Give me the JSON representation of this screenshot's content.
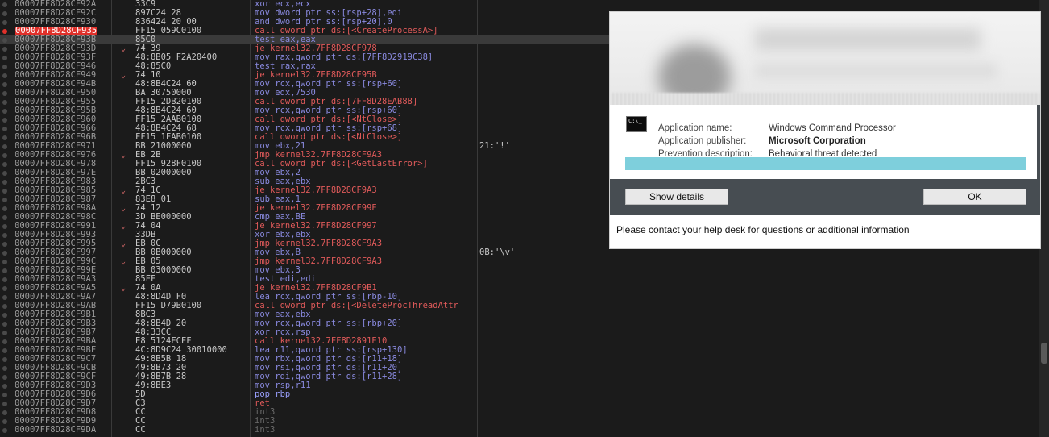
{
  "disasm": {
    "rows": [
      {
        "addr": "00007FF8D28CF92A",
        "jmp": "",
        "bytes": "33C9",
        "instr": "xor ecx,ecx",
        "kind": "",
        "cmt": ""
      },
      {
        "addr": "00007FF8D28CF92C",
        "jmp": "",
        "bytes": "897C24 28",
        "instr": "mov dword ptr ss:[rsp+28],edi",
        "kind": "",
        "cmt": ""
      },
      {
        "addr": "00007FF8D28CF930",
        "jmp": "",
        "bytes": "836424 20 00",
        "instr": "and dword ptr ss:[rsp+20],0",
        "kind": "",
        "cmt": ""
      },
      {
        "addr": "00007FF8D28CF935",
        "jmp": "",
        "bytes": "FF15 059C0100",
        "instr": "call qword ptr ds:[<CreateProcessA>]",
        "kind": "call",
        "cmt": "",
        "bp": true
      },
      {
        "addr": "00007FF8D28CF93B",
        "jmp": "",
        "bytes": "85C0",
        "instr": "test eax,eax",
        "kind": "",
        "cmt": "",
        "cur": true
      },
      {
        "addr": "00007FF8D28CF93D",
        "jmp": "⌄",
        "bytes": "74 39",
        "instr": "je kernel32.7FF8D28CF978",
        "kind": "jcc",
        "cmt": ""
      },
      {
        "addr": "00007FF8D28CF93F",
        "jmp": "",
        "bytes": "48:8B05 F2A20400",
        "instr": "mov rax,qword ptr ds:[7FF8D2919C38]",
        "kind": "",
        "cmt": ""
      },
      {
        "addr": "00007FF8D28CF946",
        "jmp": "",
        "bytes": "48:85C0",
        "instr": "test rax,rax",
        "kind": "",
        "cmt": ""
      },
      {
        "addr": "00007FF8D28CF949",
        "jmp": "⌄",
        "bytes": "74 10",
        "instr": "je kernel32.7FF8D28CF95B",
        "kind": "jcc",
        "cmt": ""
      },
      {
        "addr": "00007FF8D28CF94B",
        "jmp": "",
        "bytes": "48:8B4C24 60",
        "instr": "mov rcx,qword ptr ss:[rsp+60]",
        "kind": "",
        "cmt": ""
      },
      {
        "addr": "00007FF8D28CF950",
        "jmp": "",
        "bytes": "BA 30750000",
        "instr": "mov edx,7530",
        "kind": "",
        "cmt": ""
      },
      {
        "addr": "00007FF8D28CF955",
        "jmp": "",
        "bytes": "FF15 2DB20100",
        "instr": "call qword ptr ds:[7FF8D28EAB88]",
        "kind": "call",
        "cmt": ""
      },
      {
        "addr": "00007FF8D28CF95B",
        "jmp": "",
        "bytes": "48:8B4C24 60",
        "instr": "mov rcx,qword ptr ss:[rsp+60]",
        "kind": "",
        "cmt": ""
      },
      {
        "addr": "00007FF8D28CF960",
        "jmp": "",
        "bytes": "FF15 2AAB0100",
        "instr": "call qword ptr ds:[<NtClose>]",
        "kind": "call",
        "cmt": ""
      },
      {
        "addr": "00007FF8D28CF966",
        "jmp": "",
        "bytes": "48:8B4C24 68",
        "instr": "mov rcx,qword ptr ss:[rsp+68]",
        "kind": "",
        "cmt": ""
      },
      {
        "addr": "00007FF8D28CF96B",
        "jmp": "",
        "bytes": "FF15 1FAB0100",
        "instr": "call qword ptr ds:[<NtClose>]",
        "kind": "call",
        "cmt": ""
      },
      {
        "addr": "00007FF8D28CF971",
        "jmp": "",
        "bytes": "BB 21000000",
        "instr": "mov ebx,21",
        "kind": "",
        "cmt": "21:'!'"
      },
      {
        "addr": "00007FF8D28CF976",
        "jmp": "⌄",
        "bytes": "EB 2B",
        "instr": "jmp kernel32.7FF8D28CF9A3",
        "kind": "jcc",
        "cmt": ""
      },
      {
        "addr": "00007FF8D28CF978",
        "jmp": "",
        "bytes": "FF15 928F0100",
        "instr": "call qword ptr ds:[<GetLastError>]",
        "kind": "call",
        "cmt": ""
      },
      {
        "addr": "00007FF8D28CF97E",
        "jmp": "",
        "bytes": "BB 02000000",
        "instr": "mov ebx,2",
        "kind": "",
        "cmt": ""
      },
      {
        "addr": "00007FF8D28CF983",
        "jmp": "",
        "bytes": "2BC3",
        "instr": "sub eax,ebx",
        "kind": "",
        "cmt": ""
      },
      {
        "addr": "00007FF8D28CF985",
        "jmp": "⌄",
        "bytes": "74 1C",
        "instr": "je kernel32.7FF8D28CF9A3",
        "kind": "jcc",
        "cmt": ""
      },
      {
        "addr": "00007FF8D28CF987",
        "jmp": "",
        "bytes": "83E8 01",
        "instr": "sub eax,1",
        "kind": "",
        "cmt": ""
      },
      {
        "addr": "00007FF8D28CF98A",
        "jmp": "⌄",
        "bytes": "74 12",
        "instr": "je kernel32.7FF8D28CF99E",
        "kind": "jcc",
        "cmt": ""
      },
      {
        "addr": "00007FF8D28CF98C",
        "jmp": "",
        "bytes": "3D BE000000",
        "instr": "cmp eax,BE",
        "kind": "",
        "cmt": ""
      },
      {
        "addr": "00007FF8D28CF991",
        "jmp": "⌄",
        "bytes": "74 04",
        "instr": "je kernel32.7FF8D28CF997",
        "kind": "jcc",
        "cmt": ""
      },
      {
        "addr": "00007FF8D28CF993",
        "jmp": "",
        "bytes": "33DB",
        "instr": "xor ebx,ebx",
        "kind": "",
        "cmt": ""
      },
      {
        "addr": "00007FF8D28CF995",
        "jmp": "⌄",
        "bytes": "EB 0C",
        "instr": "jmp kernel32.7FF8D28CF9A3",
        "kind": "jcc",
        "cmt": ""
      },
      {
        "addr": "00007FF8D28CF997",
        "jmp": "",
        "bytes": "BB 0B000000",
        "instr": "mov ebx,B",
        "kind": "",
        "cmt": "0B:'\\v'"
      },
      {
        "addr": "00007FF8D28CF99C",
        "jmp": "⌄",
        "bytes": "EB 05",
        "instr": "jmp kernel32.7FF8D28CF9A3",
        "kind": "jcc",
        "cmt": ""
      },
      {
        "addr": "00007FF8D28CF99E",
        "jmp": "",
        "bytes": "BB 03000000",
        "instr": "mov ebx,3",
        "kind": "",
        "cmt": ""
      },
      {
        "addr": "00007FF8D28CF9A3",
        "jmp": "",
        "bytes": "85FF",
        "instr": "test edi,edi",
        "kind": "",
        "cmt": ""
      },
      {
        "addr": "00007FF8D28CF9A5",
        "jmp": "⌄",
        "bytes": "74 0A",
        "instr": "je kernel32.7FF8D28CF9B1",
        "kind": "jcc",
        "cmt": ""
      },
      {
        "addr": "00007FF8D28CF9A7",
        "jmp": "",
        "bytes": "48:8D4D F0",
        "instr": "lea rcx,qword ptr ss:[rbp-10]",
        "kind": "",
        "cmt": ""
      },
      {
        "addr": "00007FF8D28CF9AB",
        "jmp": "",
        "bytes": "FF15 D79B0100",
        "instr": "call qword ptr ds:[<DeleteProcThreadAttr",
        "kind": "call",
        "cmt": ""
      },
      {
        "addr": "00007FF8D28CF9B1",
        "jmp": "",
        "bytes": "8BC3",
        "instr": "mov eax,ebx",
        "kind": "",
        "cmt": ""
      },
      {
        "addr": "00007FF8D28CF9B3",
        "jmp": "",
        "bytes": "48:8B4D 20",
        "instr": "mov rcx,qword ptr ss:[rbp+20]",
        "kind": "",
        "cmt": ""
      },
      {
        "addr": "00007FF8D28CF9B7",
        "jmp": "",
        "bytes": "48:33CC",
        "instr": "xor rcx,rsp",
        "kind": "",
        "cmt": ""
      },
      {
        "addr": "00007FF8D28CF9BA",
        "jmp": "",
        "bytes": "E8 5124FCFF",
        "instr": "call kernel32.7FF8D2891E10",
        "kind": "call",
        "cmt": ""
      },
      {
        "addr": "00007FF8D28CF9BF",
        "jmp": "",
        "bytes": "4C:8D9C24 30010000",
        "instr": "lea r11,qword ptr ss:[rsp+130]",
        "kind": "",
        "cmt": ""
      },
      {
        "addr": "00007FF8D28CF9C7",
        "jmp": "",
        "bytes": "49:8B5B 18",
        "instr": "mov rbx,qword ptr ds:[r11+18]",
        "kind": "",
        "cmt": ""
      },
      {
        "addr": "00007FF8D28CF9CB",
        "jmp": "",
        "bytes": "49:8B73 20",
        "instr": "mov rsi,qword ptr ds:[r11+20]",
        "kind": "",
        "cmt": ""
      },
      {
        "addr": "00007FF8D28CF9CF",
        "jmp": "",
        "bytes": "49:8B7B 28",
        "instr": "mov rdi,qword ptr ds:[r11+28]",
        "kind": "",
        "cmt": ""
      },
      {
        "addr": "00007FF8D28CF9D3",
        "jmp": "",
        "bytes": "49:8BE3",
        "instr": "mov rsp,r11",
        "kind": "",
        "cmt": ""
      },
      {
        "addr": "00007FF8D28CF9D6",
        "jmp": "",
        "bytes": "5D",
        "instr": "pop rbp",
        "kind": "push",
        "cmt": ""
      },
      {
        "addr": "00007FF8D28CF9D7",
        "jmp": "",
        "bytes": "C3",
        "instr": "ret",
        "kind": "ret",
        "cmt": ""
      },
      {
        "addr": "00007FF8D28CF9D8",
        "jmp": "",
        "bytes": "CC",
        "instr": "int3",
        "kind": "int3",
        "cmt": ""
      },
      {
        "addr": "00007FF8D28CF9D9",
        "jmp": "",
        "bytes": "CC",
        "instr": "int3",
        "kind": "int3",
        "cmt": ""
      },
      {
        "addr": "00007FF8D28CF9DA",
        "jmp": "",
        "bytes": "CC",
        "instr": "int3",
        "kind": "int3",
        "cmt": ""
      }
    ]
  },
  "popup": {
    "app_icon_text": "C:\\_",
    "fields": [
      {
        "label": "Application name:",
        "value": "Windows Command Processor",
        "bold": false
      },
      {
        "label": "Application publisher:",
        "value": "Microsoft Corporation",
        "bold": true
      },
      {
        "label": "Prevention description:",
        "value": "Behavioral threat detected",
        "bold": false
      }
    ],
    "progress_fraction": 1.0,
    "show_details_label": "Show details",
    "ok_label": "OK",
    "helpdesk_text": "Please contact your help desk for questions or additional information",
    "colors": {
      "progress": "#7ecfdc",
      "button_bar": "#474d52",
      "breakpoint": "#e0302a"
    }
  }
}
